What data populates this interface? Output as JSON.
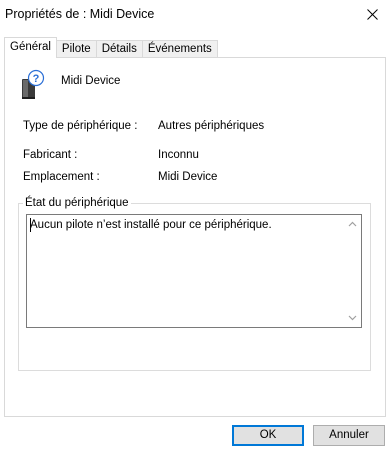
{
  "window": {
    "title": "Propriétés de : Midi Device",
    "close_icon": "close-icon"
  },
  "tabs": [
    {
      "label": "Général",
      "active": true
    },
    {
      "label": "Pilote",
      "active": false
    },
    {
      "label": "Détails",
      "active": false
    },
    {
      "label": "Événements",
      "active": false
    }
  ],
  "device": {
    "icon": "unknown-device-icon",
    "name": "Midi Device"
  },
  "properties": [
    {
      "label": "Type de périphérique :",
      "value": "Autres périphériques"
    },
    {
      "label": "Fabricant :",
      "value": "Inconnu"
    },
    {
      "label": "Emplacement :",
      "value": "Midi Device"
    }
  ],
  "status_group": {
    "legend": "État du périphérique",
    "text": "Aucun pilote n’est installé pour ce périphérique."
  },
  "buttons": {
    "ok": "OK",
    "cancel": "Annuler"
  },
  "colors": {
    "accent": "#0078d7",
    "button_bg": "#e1e1e1",
    "border": "#d9d9d9"
  }
}
